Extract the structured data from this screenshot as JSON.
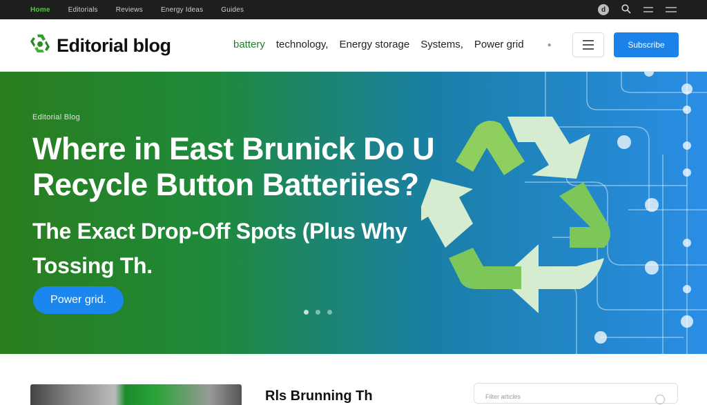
{
  "topbar": {
    "links": [
      "Home",
      "Editorials",
      "Reviews",
      "Energy Ideas",
      "Guides"
    ]
  },
  "header": {
    "logo_text": "Editorial blog",
    "nav": [
      "battery",
      "technology,",
      "Energy storage",
      "Systems,",
      "Power grid"
    ],
    "cta_label": "Subscribe"
  },
  "hero": {
    "eyebrow": "Editorial Blog",
    "title": "Where in East Brunick Do U Recycle Button Batteriies?",
    "subtitle": "The Exact Drop-Off Spots (Plus Why Tossing Th.",
    "pill_label": "Power grid.",
    "slides": 3,
    "active_slide": 0
  },
  "bottom": {
    "card_title": "Rls Brunning Th",
    "side_label": "Filter articles"
  },
  "colors": {
    "accent": "#1a82e8",
    "brand_green": "#4ccd3b",
    "hero_left": "#2a7d1e",
    "hero_right": "#2a8ee6"
  }
}
